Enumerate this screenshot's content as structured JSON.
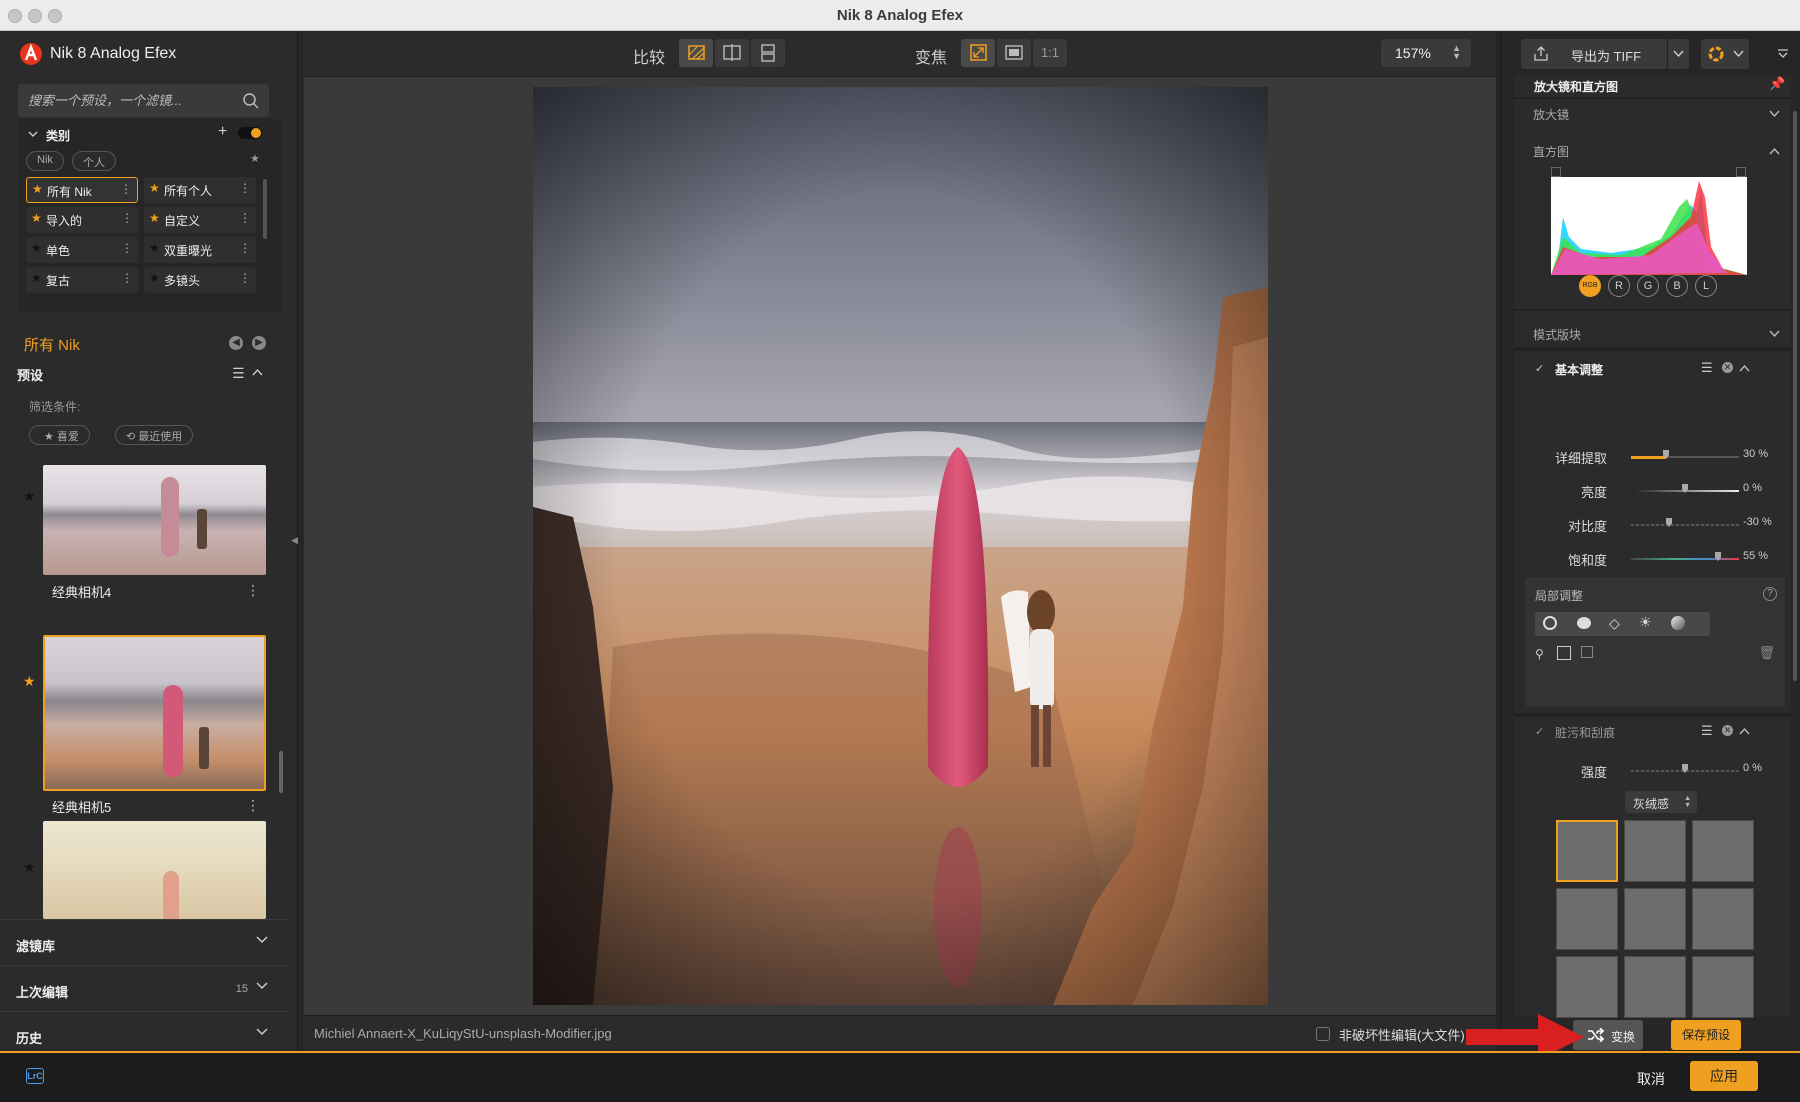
{
  "window": {
    "title": "Nik 8 Analog Efex"
  },
  "app": {
    "name": "Nik 8 Analog Efex"
  },
  "search": {
    "placeholder": "搜索一个预设，一个滤镜..."
  },
  "categories": {
    "title": "类别",
    "chips": [
      "Nik",
      "个人"
    ],
    "items": [
      {
        "label": "所有 Nik",
        "star": "orange",
        "active": true
      },
      {
        "label": "所有个人",
        "star": "orange"
      },
      {
        "label": "导入的",
        "star": "orange"
      },
      {
        "label": "自定义",
        "star": "orange"
      },
      {
        "label": "单色",
        "star": "black"
      },
      {
        "label": "双重曝光",
        "star": "black"
      },
      {
        "label": "复古",
        "star": "black"
      },
      {
        "label": "多镜头",
        "star": "black"
      }
    ]
  },
  "current_group": {
    "label": "所有 Nik"
  },
  "presets": {
    "title": "预设",
    "filter_label": "筛选条件:",
    "filters": [
      "喜爱",
      "最近使用"
    ],
    "thumbs": [
      {
        "label": "经典相机4",
        "star": "black"
      },
      {
        "label": "经典相机5",
        "star": "orange",
        "selected": true
      },
      {
        "label": "",
        "star": "black"
      }
    ]
  },
  "folds": {
    "filter_library": "滤镜库",
    "last_edits": "上次编辑",
    "last_edits_count": "15",
    "history": "历史"
  },
  "toolbar": {
    "compare_label": "比较",
    "zoom_label": "变焦",
    "one_to_one": "1:1",
    "zoom_value": "157%"
  },
  "status": {
    "filename": "Michiel Annaert-X_KuLiqyStU-unsplash-Modifier.jpg",
    "nondestructive_label": "非破坏性编辑(大文件)"
  },
  "right": {
    "export_label": "导出为 TIFF",
    "loupe_histogram_title": "放大镜和直方图",
    "loupe_label": "放大镜",
    "histogram_label": "直方图",
    "channels": [
      "RGB",
      "R",
      "G",
      "B",
      "L"
    ],
    "modes_label": "模式版块",
    "basic": {
      "title": "基本调整",
      "sliders": [
        {
          "label": "详细提取",
          "value": "30 %",
          "level": 0.3
        },
        {
          "label": "亮度",
          "value": "0 %",
          "level": 0.5
        },
        {
          "label": "对比度",
          "value": "-30 %",
          "level": 0.35
        },
        {
          "label": "饱和度",
          "value": "55 %",
          "level": 0.78
        }
      ]
    },
    "local_label": "局部调整",
    "dust": {
      "title": "脏污和刮痕",
      "strength_label": "强度",
      "strength_value": "0 %",
      "type_value": "灰绒感"
    }
  },
  "bottom": {
    "lrc": "LrC",
    "randomize": "变换",
    "save_preset": "保存预设",
    "cancel": "取消",
    "apply": "应用"
  },
  "colors": {
    "accent": "#f0a020",
    "arrow": "#d91f1f"
  }
}
